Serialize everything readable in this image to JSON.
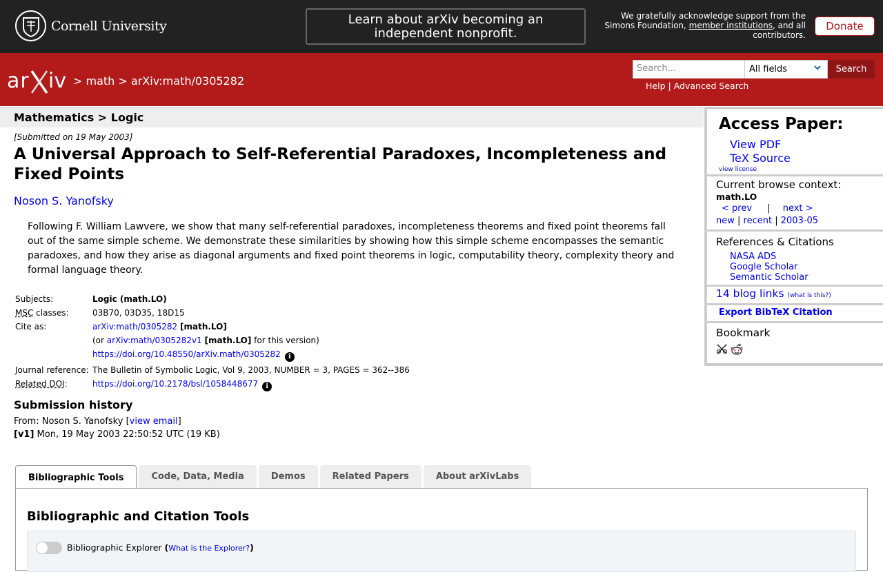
{
  "cornell": {
    "name": "Cornell University",
    "banner": "Learn about arXiv becoming an independent nonprofit.",
    "support_pre": "We gratefully acknowledge support from the Simons Foundation, ",
    "support_link": "member institutions",
    "support_post": ", and all contributors.",
    "donate": "Donate"
  },
  "header": {
    "crumb_sep1": ">",
    "crumb_math": "math",
    "crumb_sep2": ">",
    "crumb_id": "arXiv:math/0305282",
    "search_placeholder": "Search...",
    "field_value": "All fields",
    "search_button": "Search",
    "help": "Help",
    "help_sep": "|",
    "advanced": "Advanced Search"
  },
  "paper": {
    "subject_bar": "Mathematics > Logic",
    "submitted": "[Submitted on 19 May 2003]",
    "title": "A Universal Approach to Self-Referential Paradoxes, Incompleteness and Fixed Points",
    "author": "Noson S. Yanofsky",
    "abstract": "Following F. William Lawvere, we show that many self-referential paradoxes, incompleteness theorems and fixed point theorems fall out of the same simple scheme. We demonstrate these similarities by showing how this simple scheme encompasses the semantic paradoxes, and how they arise as diagonal arguments and fixed point theorems in logic, computability theory, complexity theory and formal language theory."
  },
  "meta": {
    "subjects_label": "Subjects:",
    "subjects_value": "Logic (math.LO)",
    "msc_abbr": "MSC",
    "msc_label_rest": " classes:",
    "msc_value": "03B70, 03D35, 18D15",
    "cite_label": "Cite as:",
    "cite_id": "arXiv:math/0305282",
    "cite_tag": "[math.LO]",
    "cite_or": "(or ",
    "cite_v1": "arXiv:math/0305282v1",
    "cite_v1_tag": "[math.LO]",
    "cite_for": " for this version)",
    "cite_doi": "https://doi.org/10.48550/arXiv.math/0305282",
    "journal_label": "Journal reference:",
    "journal_value": "The Bulletin of Symbolic Logic, Vol 9, 2003, NUMBER = 3, PAGES = 362--386",
    "rel_doi_abbr": "Related DOI",
    "rel_doi_colon": ":",
    "rel_doi_value": "https://doi.org/10.2178/bsl/1058448677"
  },
  "history": {
    "heading": "Submission history",
    "from_label": "From: Noson S. Yanofsky [",
    "view_email": "view email",
    "from_close": "]",
    "v1_tag": "[v1]",
    "v1_text": " Mon, 19 May 2003 22:50:52 UTC (19 KB)"
  },
  "tabs": [
    {
      "label": "Bibliographic Tools"
    },
    {
      "label": "Code, Data, Media"
    },
    {
      "label": "Demos"
    },
    {
      "label": "Related Papers"
    },
    {
      "label": "About arXivLabs"
    }
  ],
  "panel": {
    "heading": "Bibliographic and Citation Tools",
    "explorer_label": "Bibliographic Explorer ",
    "explorer_open": "(",
    "explorer_link": "What is the Explorer?",
    "explorer_close": ")"
  },
  "sidebar": {
    "access_heading": "Access Paper:",
    "view_pdf": "View PDF",
    "tex_source": "TeX Source",
    "view_license": "view license",
    "context_label": "Current browse context:",
    "context_value": "math.LO",
    "prev": "< prev",
    "pn_sep": "|",
    "next": "next >",
    "new": "new",
    "recent": "recent",
    "date": "2003-05",
    "date_sep": "|",
    "refs_heading": "References & Citations",
    "refs": [
      "NASA ADS",
      "Google Scholar",
      "Semantic Scholar"
    ],
    "blog_links": "14 blog links",
    "blog_what": "(what is this?)",
    "bibtex": "Export BibTeX Citation",
    "bookmark_heading": "Bookmark"
  },
  "colors": {
    "arxiv_red": "#b31b1b",
    "cornell_bar": "#222222",
    "link": "#0000ee"
  }
}
